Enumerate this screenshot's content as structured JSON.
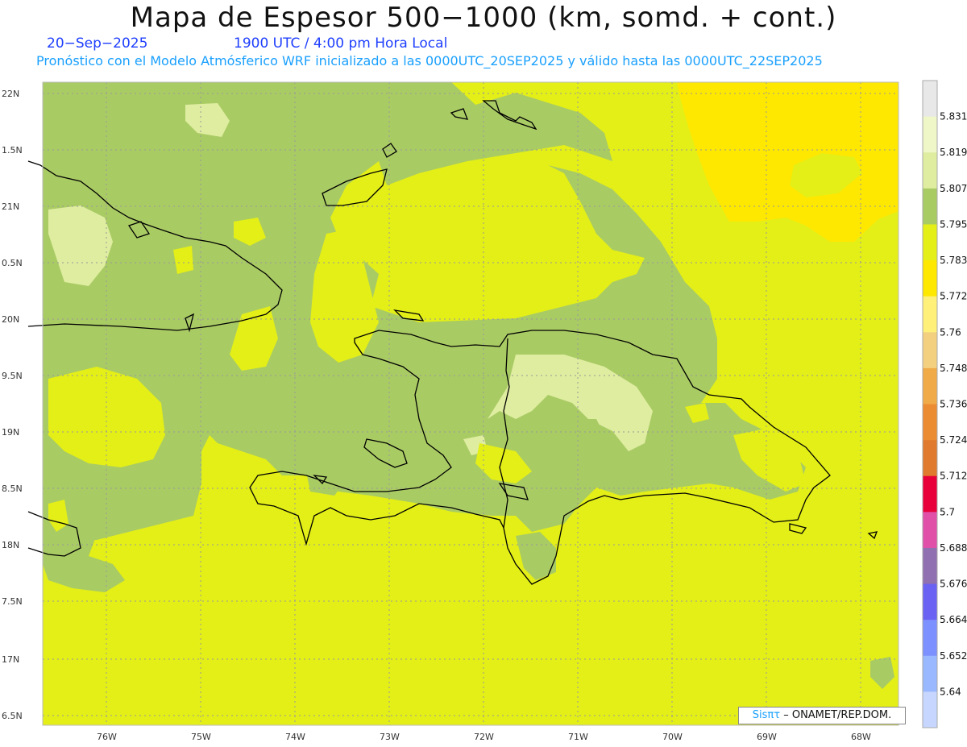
{
  "header": {
    "title": "Mapa de Espesor 500−1000 (km, somd. + cont.)",
    "date": "20−Sep−2025",
    "time": "1900 UTC / 4:00 pm Hora Local",
    "model_line": "Pronóstico con el Modelo Atmósferico WRF inicializado a las 0000UTC_20SEP2025 y válido hasta las  0000UTC_22SEP2025"
  },
  "map": {
    "lat_labels": [
      "22N",
      "1.5N",
      "21N",
      "0.5N",
      "20N",
      "9.5N",
      "19N",
      "8.5N",
      "18N",
      "7.5N",
      "17N",
      "6.5N"
    ],
    "lon_labels": [
      "76W",
      "75W",
      "74W",
      "73W",
      "72W",
      "71W",
      "70W",
      "69W",
      "68W"
    ],
    "colors": {
      "fill_5783": "#e3ef17",
      "fill_5795": "#a9cb64",
      "fill_5807": "#dfeda0",
      "fill_5772": "#ffe800",
      "coast": "#000000"
    }
  },
  "colorbar": {
    "labels": [
      "5.831",
      "5.819",
      "5.807",
      "5.795",
      "5.783",
      "5.772",
      "5.76",
      "5.748",
      "5.736",
      "5.724",
      "5.712",
      "5.7",
      "5.688",
      "5.676",
      "5.664",
      "5.652",
      "5.64"
    ],
    "colors": [
      "#e8e8e8",
      "#eff7c8",
      "#dfeda0",
      "#a9cb64",
      "#e3ef17",
      "#ffe800",
      "#fff07a",
      "#f2d080",
      "#f0aa48",
      "#eb8b32",
      "#e07a2e",
      "#e8003a",
      "#e050a8",
      "#9070b0",
      "#6a62f2",
      "#7d90ff",
      "#9ab8ff",
      "#c6d6ff"
    ]
  },
  "credit": {
    "brand": "Sisπτ",
    "text": "– ONAMET/REP.DOM."
  }
}
